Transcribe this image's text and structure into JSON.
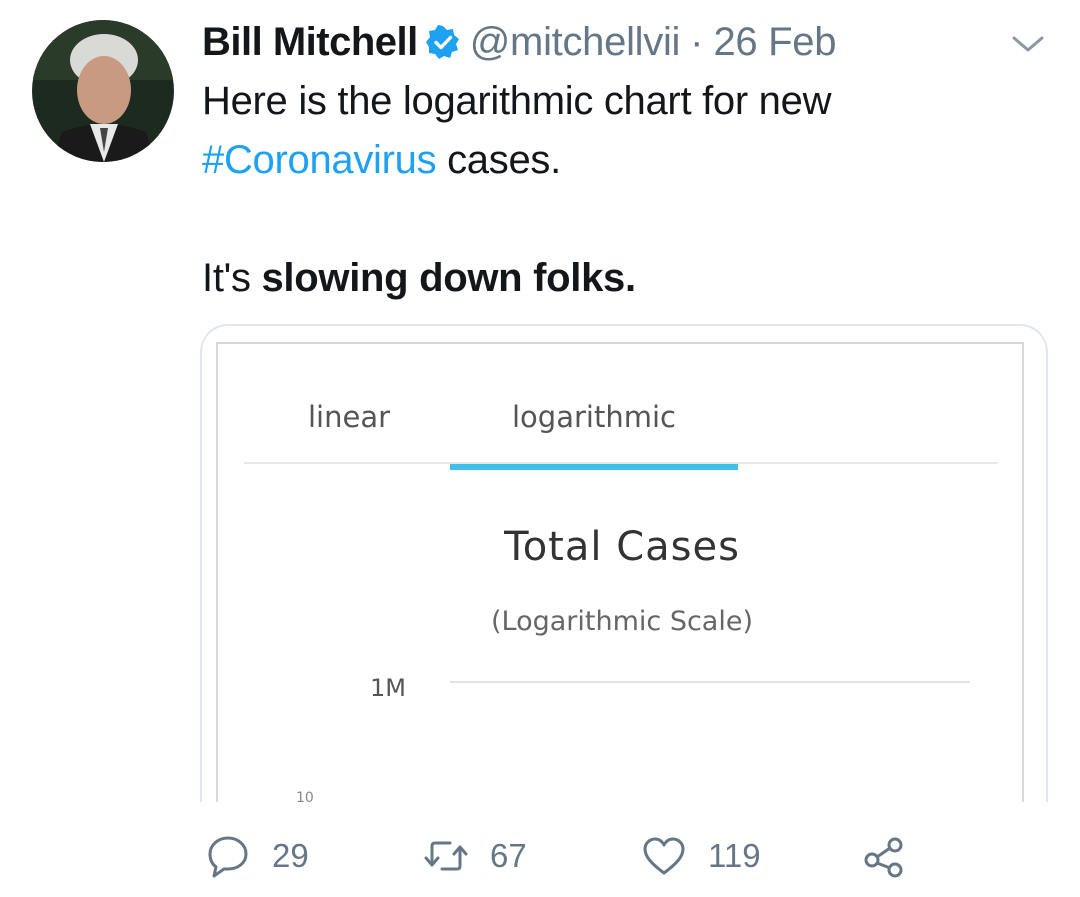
{
  "tweet": {
    "author": {
      "display_name": "Bill Mitchell",
      "handle": "@mitchellvii",
      "verified": true,
      "avatar_icon": "profile-photo"
    },
    "separator": "·",
    "date": "26 Feb",
    "text": {
      "line1": "Here is the logarithmic chart for new",
      "hashtag": "#Coronavirus",
      "line2_rest": " cases.",
      "line3_prefix": "It's ",
      "line3_bold": "slowing down folks."
    },
    "actions": {
      "replies": "29",
      "retweets": "67",
      "likes": "119"
    }
  },
  "embedded_chart": {
    "tabs": [
      {
        "label": "linear",
        "selected": false
      },
      {
        "label": "logarithmic",
        "selected": true
      }
    ],
    "title": "Total Cases",
    "subtitle": "(Logarithmic Scale)",
    "y_tick": "1M",
    "cut_label": "10"
  },
  "chart_data": {
    "type": "line",
    "title": "Total Cases",
    "subtitle": "(Logarithmic Scale)",
    "y_scale": "log",
    "yticks": [
      "1M"
    ],
    "grid": true,
    "series": []
  },
  "colors": {
    "link": "#1da1f2",
    "verified_badge": "#1da1f2",
    "secondary_text": "#657786",
    "tab_accent": "#3fc0ea"
  }
}
